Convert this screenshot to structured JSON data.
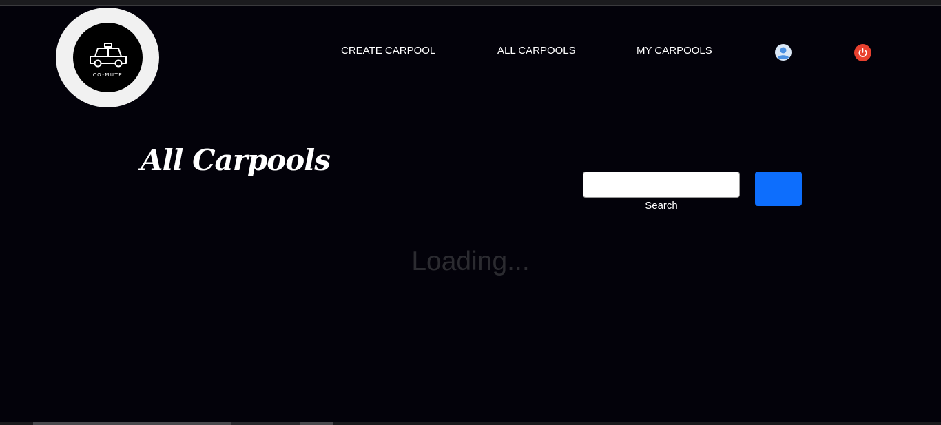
{
  "logo": {
    "text": "CO-MUTE",
    "icon": "taxi-car-icon"
  },
  "nav": {
    "items": [
      {
        "label": "CREATE CARPOOL"
      },
      {
        "label": "ALL CARPOOLS"
      },
      {
        "label": "MY CARPOOLS"
      }
    ],
    "profile_icon": "user-avatar-icon",
    "logout_icon": "power-icon",
    "colors": {
      "profile": "#4a90e2",
      "logout": "#e8412f"
    }
  },
  "main": {
    "title": "All Carpools",
    "search": {
      "value": "",
      "placeholder": "",
      "label": "Search",
      "button_label": "",
      "button_color": "#0d6efd"
    },
    "loading_text": "Loading..."
  },
  "theme": {
    "background": "#03020a",
    "text": "#ffffff"
  }
}
